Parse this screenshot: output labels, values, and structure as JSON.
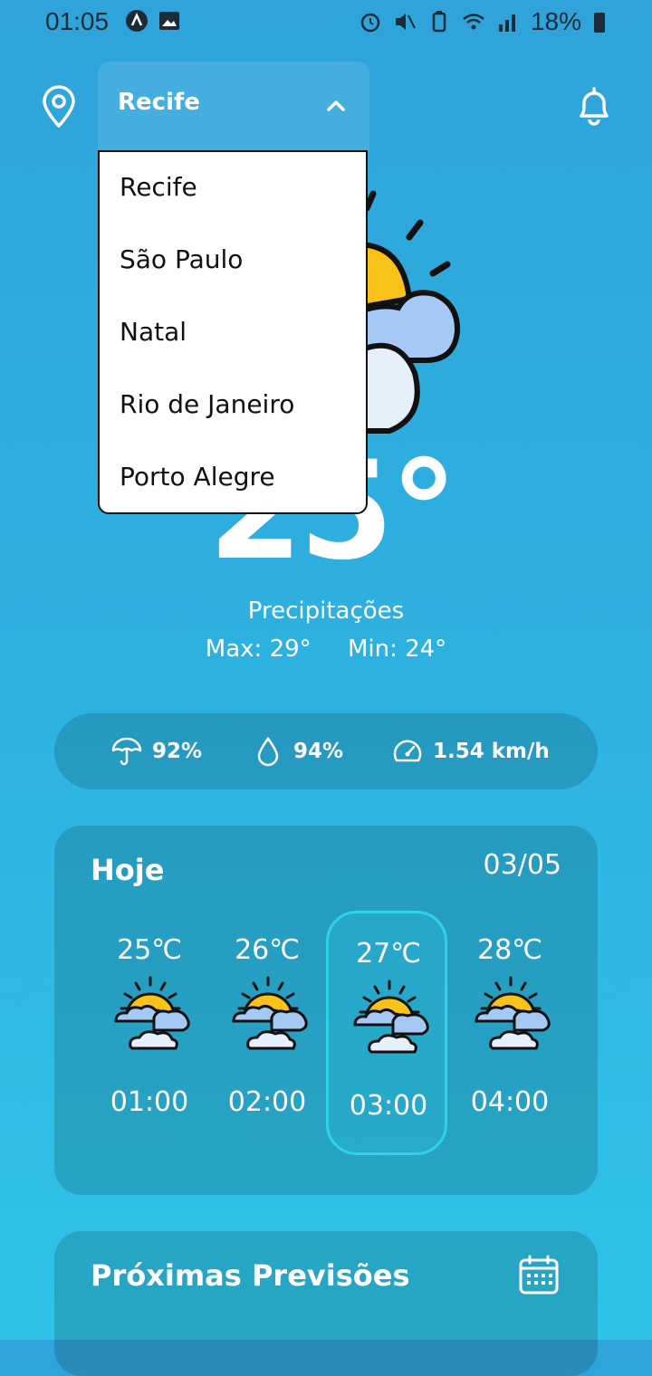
{
  "status_bar": {
    "time": "01:05",
    "battery": "18%"
  },
  "location": {
    "selected": "Recife"
  },
  "dropdown": {
    "items": [
      "Recife",
      "São Paulo",
      "Natal",
      "Rio de Janeiro",
      "Porto Alegre"
    ]
  },
  "weather": {
    "temperature": "25°",
    "condition": "Precipitações",
    "max": "Max: 29°",
    "min": "Min: 24°"
  },
  "stats": {
    "rain": "92%",
    "humidity": "94%",
    "wind": "1.54 km/h"
  },
  "today": {
    "title": "Hoje",
    "date": "03/05",
    "hours": [
      {
        "temp": "25℃",
        "time": "01:00"
      },
      {
        "temp": "26℃",
        "time": "02:00"
      },
      {
        "temp": "27℃",
        "time": "03:00"
      },
      {
        "temp": "28℃",
        "time": "04:00"
      }
    ],
    "active_index": 2
  },
  "next": {
    "title": "Próximas Previsões"
  },
  "colors": {
    "accent": "#2fd2ee",
    "sun": "#F9C21A",
    "cloud": "#A6C8F5"
  }
}
